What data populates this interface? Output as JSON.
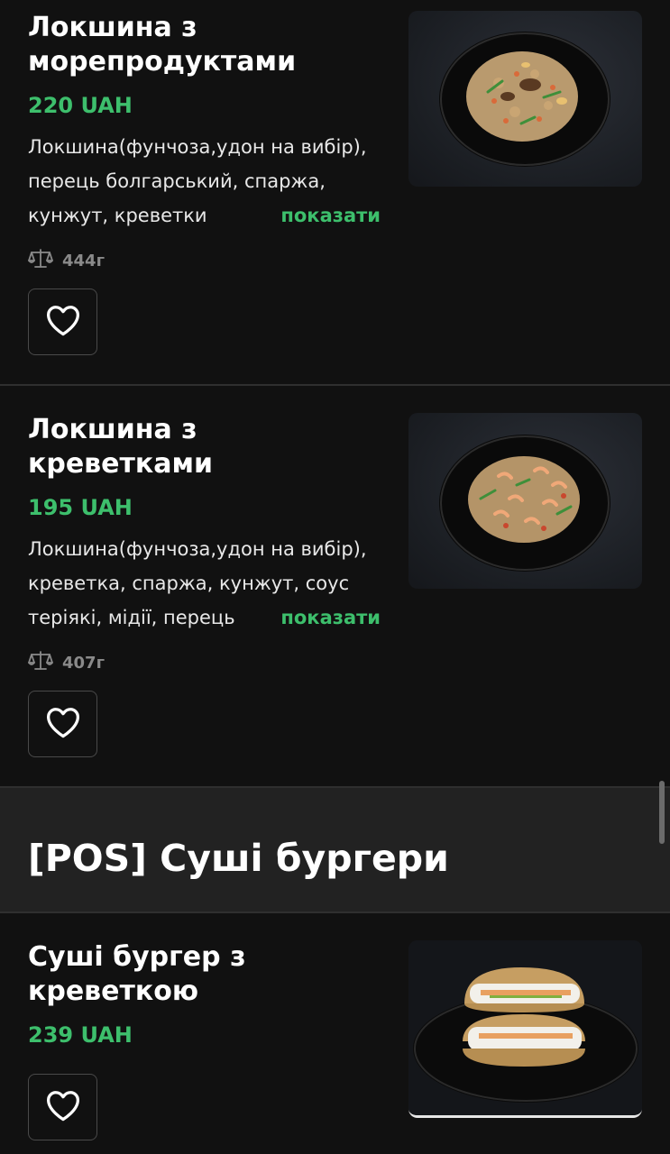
{
  "items": [
    {
      "title": "Локшина з морепродуктами",
      "price": "220 UAH",
      "description": "Локшина(фунчоза,удон на вибір), перець болгарський, спаржа, кунжут, креветки",
      "show_more": "показати",
      "weight": "444г"
    },
    {
      "title": "Локшина з креветками",
      "price": "195 UAH",
      "description": "Локшина(фунчоза,удон на вибір), креветка, спаржа, кунжут, соус теріякі, мідії, перець",
      "show_more": "показати",
      "weight": "407г"
    },
    {
      "title": "Суші бургер з креветкою",
      "price": "239 UAH"
    }
  ],
  "section": {
    "title": "[POS] Суші бургери"
  },
  "icons": {
    "favorite": "heart-outline-icon",
    "weight": "scales-icon"
  },
  "colors": {
    "background": "#111111",
    "section_background": "#222222",
    "accent": "#3dbf6c",
    "muted": "#8a8a8a"
  }
}
